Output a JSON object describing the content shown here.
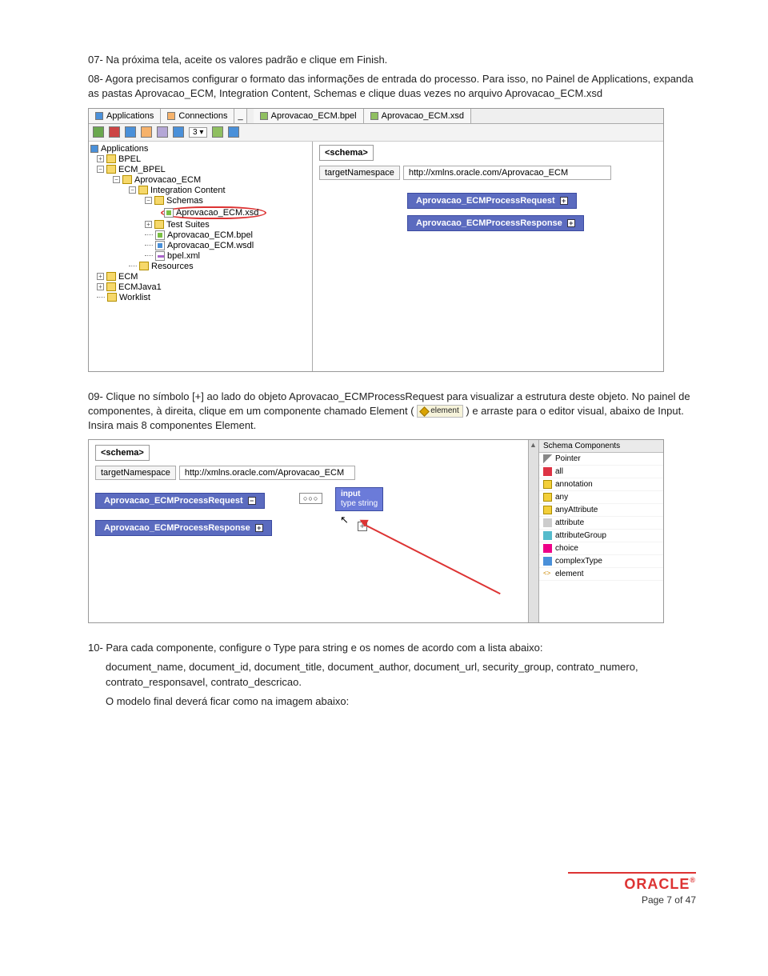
{
  "doc": {
    "p07": "07- Na próxima tela, aceite os valores padrão e clique em Finish.",
    "p08": "08- Agora precisamos configurar o formato das informações de entrada do processo. Para isso, no Painel de Applications, expanda as pastas Aprovacao_ECM, Integration Content, Schemas e clique duas vezes no arquivo Aprovacao_ECM.xsd",
    "p09a": "09- Clique no símbolo [+] ao lado do objeto Aprovacao_ECMProcessRequest para visualizar a estrutura deste objeto. No painel de componentes, à direita, clique em um componente chamado Element (",
    "p09b": ") e arraste para o editor visual, abaixo de Input. Insira mais 8 componentes Element.",
    "p10a": "10- Para cada componente, configure o Type para string e os nomes de acordo com a lista abaixo:",
    "p10b": "document_name, document_id, document_title, document_author, document_url, security_group, contrato_numero, contrato_responsavel, contrato_descricao.",
    "p10c": "O modelo final deverá ficar como na imagem abaixo:"
  },
  "shot1": {
    "tab_apps": "Applications",
    "tab_conn": "Connections",
    "tab_bpel": "Aprovacao_ECM.bpel",
    "tab_xsd": "Aprovacao_ECM.xsd",
    "toolbar_num": "3",
    "tree": {
      "root": "Applications",
      "bpel": "BPEL",
      "ecm_bpel": "ECM_BPEL",
      "aprov": "Aprovacao_ECM",
      "integ": "Integration Content",
      "schemas": "Schemas",
      "xsd": "Aprovacao_ECM.xsd",
      "tests": "Test Suites",
      "bpelf": "Aprovacao_ECM.bpel",
      "wsdl": "Aprovacao_ECM.wsdl",
      "bpelxml": "bpel.xml",
      "res": "Resources",
      "ecm": "ECM",
      "ecmj": "ECMJava1",
      "wl": "Worklist"
    },
    "schema_lbl": "<schema>",
    "tns_lbl": "targetNamespace",
    "tns_val": "http://xmlns.oracle.com/Aprovacao_ECM",
    "req": "Aprovacao_ECMProcessRequest",
    "resp": "Aprovacao_ECMProcessResponse"
  },
  "chip": {
    "label": "element"
  },
  "shot2": {
    "schema_lbl": "<schema>",
    "tns_lbl": "targetNamespace",
    "tns_val": "http://xmlns.oracle.com/Aprovacao_ECM",
    "req": "Aprovacao_ECMProcessRequest",
    "resp": "Aprovacao_ECMProcessResponse",
    "input_lbl": "input",
    "input_type": "type string",
    "panel_title": "Schema Components",
    "items": [
      "Pointer",
      "all",
      "annotation",
      "any",
      "anyAttribute",
      "attribute",
      "attributeGroup",
      "choice",
      "complexType",
      "element"
    ]
  },
  "footer": {
    "brand": "ORACLE",
    "page": "Page 7 of 47"
  }
}
